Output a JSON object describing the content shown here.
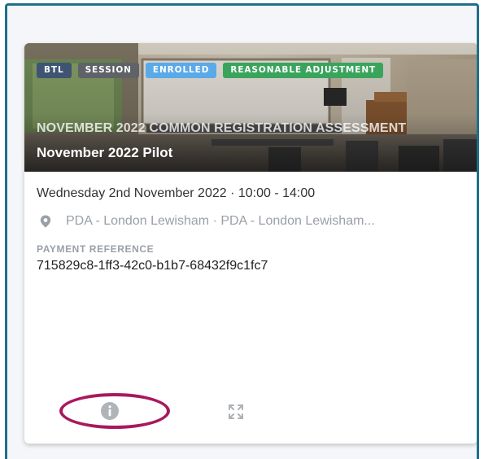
{
  "colors": {
    "frame_border": "#1f6f8b",
    "badge_btl": "#3f5373",
    "badge_session": "#5f6368",
    "badge_enrolled": "#5aa9e8",
    "badge_reasonable_adjustment": "#3aa45c",
    "highlight": "#a8195c"
  },
  "card": {
    "badges": [
      "BTL",
      "SESSION",
      "ENROLLED",
      "REASONABLE ADJUSTMENT"
    ],
    "subtitle": "NOVEMBER 2022 COMMON REGISTRATION ASSESSMENT",
    "title": "November 2022 Pilot",
    "datetime": "Wednesday 2nd November 2022 · 10:00 - 14:00",
    "location": "PDA - London Lewisham · PDA - London Lewisham...",
    "location_icon": "map-pin-icon",
    "payment_reference_label": "PAYMENT REFERENCE",
    "payment_reference_value": "715829c8-1ff3-42c0-b1b7-68432f9c1fc7",
    "footer_icons": [
      "info-icon",
      "expand-icon"
    ]
  }
}
